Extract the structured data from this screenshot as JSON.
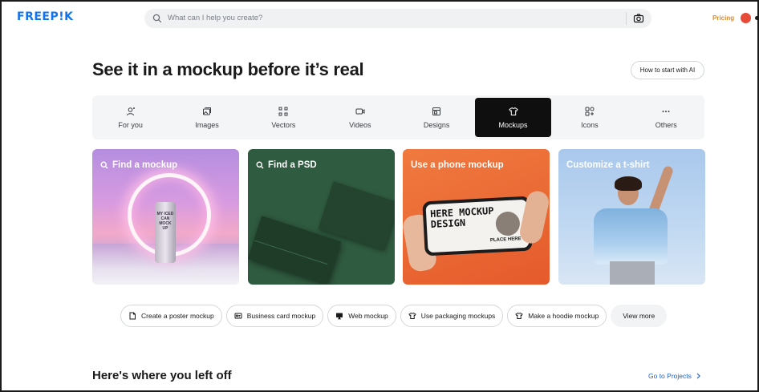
{
  "header": {
    "logo": "FREEP!K",
    "search_placeholder": "What can I help you create?",
    "pricing": "Pricing"
  },
  "hero": {
    "title": "See it in a mockup before it’s real",
    "how_to_button": "How to start with AI"
  },
  "categories": [
    {
      "label": "For you",
      "icon": "sparkle-user-icon"
    },
    {
      "label": "Images",
      "icon": "images-icon"
    },
    {
      "label": "Vectors",
      "icon": "vectors-icon"
    },
    {
      "label": "Videos",
      "icon": "video-icon"
    },
    {
      "label": "Designs",
      "icon": "designs-icon"
    },
    {
      "label": "Mockups",
      "icon": "tshirt-icon",
      "active": true
    },
    {
      "label": "Icons",
      "icon": "icons-icon"
    },
    {
      "label": "Others",
      "icon": "more-icon"
    }
  ],
  "cards": [
    {
      "label": "Find a mockup",
      "has_search_icon": true,
      "can_text": "MY ICED CAN MOCK UP"
    },
    {
      "label": "Find a PSD",
      "has_search_icon": true
    },
    {
      "label": "Use a phone mockup",
      "has_search_icon": false,
      "phone_big": "HERE MOCKUP DESIGN",
      "phone_small": "PLACE HERE"
    },
    {
      "label": "Customize a t-shirt",
      "has_search_icon": false
    }
  ],
  "chips": [
    {
      "label": "Create a poster mockup",
      "icon": "poster-icon"
    },
    {
      "label": "Business card mockup",
      "icon": "business-card-icon"
    },
    {
      "label": "Web mockup",
      "icon": "monitor-icon"
    },
    {
      "label": "Use packaging mockups",
      "icon": "packaging-icon"
    },
    {
      "label": "Make a hoodie mockup",
      "icon": "hoodie-icon"
    },
    {
      "label": "View more",
      "icon": ""
    }
  ],
  "bottom": {
    "left_off_title": "Here's where you left off",
    "go_to_projects": "Go to Projects"
  },
  "colors": {
    "brand_blue": "#1273eb",
    "pricing_orange": "#e0892a",
    "active_tab": "#0f0f0f",
    "link_blue": "#1a5fd1"
  }
}
